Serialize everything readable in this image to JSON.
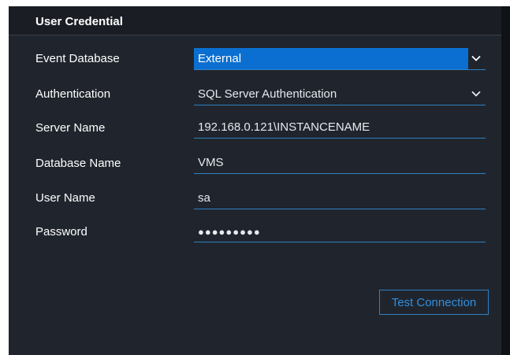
{
  "section": {
    "title": "User Credential"
  },
  "fields": {
    "event_database": {
      "label": "Event Database",
      "value": "External"
    },
    "authentication": {
      "label": "Authentication",
      "value": "SQL Server Authentication"
    },
    "server_name": {
      "label": "Server Name",
      "value": "192.168.0.121\\INSTANCENAME"
    },
    "database_name": {
      "label": "Database Name",
      "value": "VMS"
    },
    "user_name": {
      "label": "User Name",
      "value": "sa"
    },
    "password": {
      "label": "Password",
      "value": "●●●●●●●●●"
    }
  },
  "actions": {
    "test_connection_label": "Test Connection"
  },
  "icons": {
    "dropdown": "chevron-down-icon"
  },
  "colors": {
    "panel_background": "#20252d",
    "header_background": "#1a1d23",
    "accent": "#2f7fc1",
    "selection": "#0a6fd0",
    "text": "#ffffff"
  }
}
